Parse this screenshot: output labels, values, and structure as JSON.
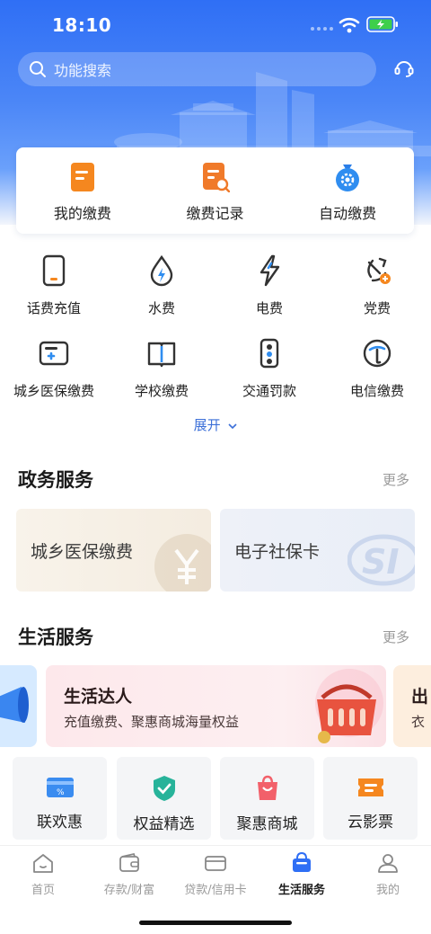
{
  "status_bar": {
    "time": "18:10"
  },
  "search": {
    "placeholder": "功能搜索"
  },
  "quick_actions": [
    {
      "label": "我的缴费",
      "icon": "bill-document-icon"
    },
    {
      "label": "缴费记录",
      "icon": "record-search-icon"
    },
    {
      "label": "自动缴费",
      "icon": "money-bag-gear-icon"
    }
  ],
  "services": [
    {
      "label": "话费充值",
      "icon": "phone-icon"
    },
    {
      "label": "水费",
      "icon": "water-drop-icon"
    },
    {
      "label": "电费",
      "icon": "lightning-icon"
    },
    {
      "label": "党费",
      "icon": "party-emblem-icon"
    },
    {
      "label": "城乡医保缴费",
      "icon": "medical-card-icon"
    },
    {
      "label": "学校缴费",
      "icon": "book-icon"
    },
    {
      "label": "交通罚款",
      "icon": "traffic-light-icon"
    },
    {
      "label": "电信缴费",
      "icon": "telecom-icon"
    }
  ],
  "expand_label": "展开",
  "gov_section": {
    "title": "政务服务",
    "more": "更多",
    "cards": [
      {
        "label": "城乡医保缴费"
      },
      {
        "label": "电子社保卡"
      }
    ]
  },
  "life_section": {
    "title": "生活服务",
    "more": "更多",
    "banner": {
      "title": "生活达人",
      "subtitle": "充值缴费、聚惠商城海量权益"
    },
    "peek_right": {
      "title": "出",
      "subtitle": "衣"
    },
    "promos": [
      {
        "label": "联欢惠",
        "icon": "coupon-card-icon"
      },
      {
        "label": "权益精选",
        "icon": "badge-check-icon"
      },
      {
        "label": "聚惠商城",
        "icon": "shopping-bag-icon"
      },
      {
        "label": "云影票",
        "icon": "ticket-icon"
      }
    ]
  },
  "tabbar": {
    "tabs": [
      {
        "label": "首页",
        "icon": "home-icon"
      },
      {
        "label": "存款/财富",
        "icon": "wallet-icon"
      },
      {
        "label": "贷款/信用卡",
        "icon": "card-icon"
      },
      {
        "label": "生活服务",
        "icon": "shopping-basket-icon",
        "active": true
      },
      {
        "label": "我的",
        "icon": "person-icon"
      }
    ]
  },
  "colors": {
    "brand_blue": "#2f6ff5",
    "accent_orange": "#f5871f",
    "text_muted": "#9a9a9a"
  }
}
